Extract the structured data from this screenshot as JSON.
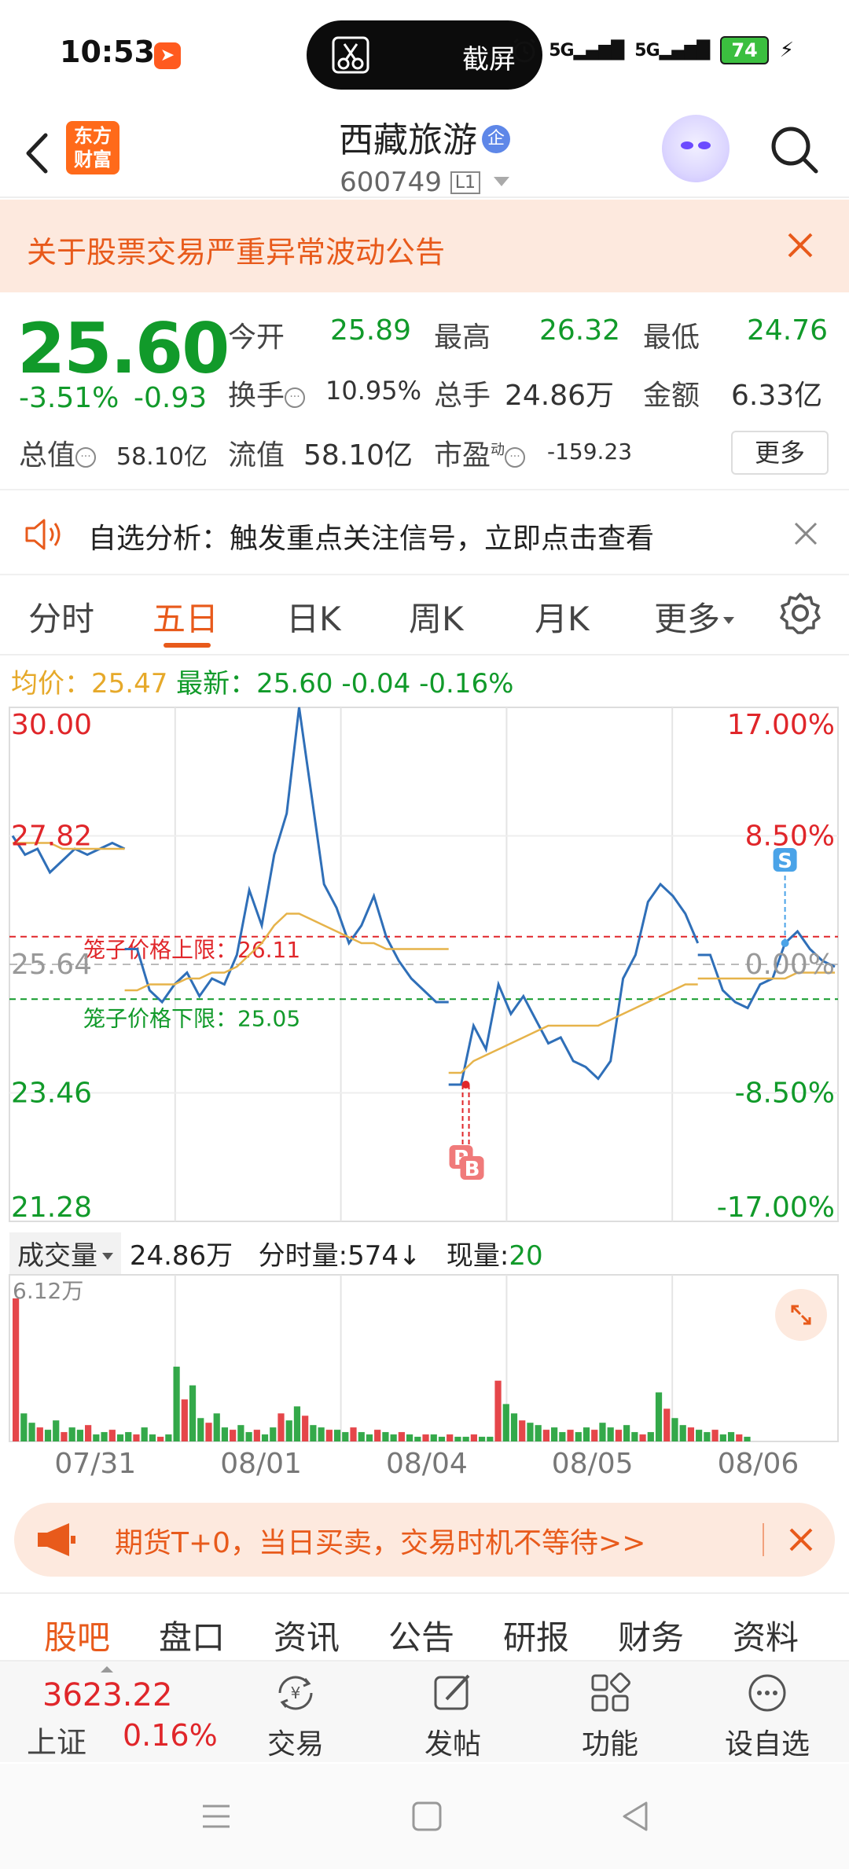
{
  "status_bar": {
    "time": "10:53",
    "screenshot_label": "截屏",
    "signal1": "5G",
    "signal2": "5G",
    "battery": "74",
    "icons": [
      "app-notification-icon",
      "scissors-icon",
      "alarm-icon",
      "signal-icon",
      "battery-icon",
      "charging-icon"
    ]
  },
  "header": {
    "logo_line1": "东方",
    "logo_line2": "财富",
    "stock_name": "西藏旅游",
    "badge": "企",
    "stock_code": "600749",
    "level_badge": "L1"
  },
  "notice": {
    "text": "关于股票交易严重异常波动公告"
  },
  "quote": {
    "price": "25.60",
    "change_pct": "-3.51%",
    "change": "-0.93",
    "open_label": "今开",
    "open": "25.89",
    "high_label": "最高",
    "high": "26.32",
    "low_label": "最低",
    "low": "24.76",
    "turnover_label": "换手",
    "turnover": "10.95%",
    "volume_label": "总手",
    "volume": "24.86万",
    "amount_label": "金额",
    "amount": "6.33亿",
    "mktcap_label": "总值",
    "mktcap": "58.10亿",
    "float_label": "流值",
    "float": "58.10亿",
    "pe_label": "市盈",
    "pe_sup": "动",
    "pe": "-159.23",
    "more": "更多"
  },
  "analysis": {
    "text": "自选分析：触发重点关注信号，立即点击查看"
  },
  "tabs": {
    "items": [
      "分时",
      "五日",
      "日K",
      "周K",
      "月K",
      "更多"
    ],
    "active_index": 1
  },
  "avg_bar": {
    "avg_label": "均价：",
    "avg": "25.47",
    "latest_label": "最新：",
    "latest": "25.60",
    "latest_chg": "-0.04",
    "latest_pct": "-0.16%"
  },
  "chart_data": {
    "type": "line",
    "title": "",
    "days": [
      "07/31",
      "08/01",
      "08/04",
      "08/05",
      "08/06"
    ],
    "price_axis": [
      "30.00",
      "27.82",
      "25.64",
      "23.46",
      "21.28"
    ],
    "pct_axis": [
      "17.00%",
      "8.50%",
      "0.00%",
      "-8.50%",
      "-17.00%"
    ],
    "ylim": [
      21.28,
      30.0
    ],
    "reference_price": 25.64,
    "cage_upper_label": "笼子价格上限：",
    "cage_upper": "26.11",
    "cage_lower_label": "笼子价格下限：",
    "cage_lower": "25.05",
    "markers": [
      "P",
      "B",
      "S"
    ],
    "series": [
      {
        "name": "price",
        "color": "#2f6fb8",
        "values": [
          27.82,
          27.5,
          27.6,
          27.2,
          27.4,
          27.6,
          27.5,
          27.6,
          27.7,
          27.6,
          25.9,
          25.2,
          25.0,
          25.3,
          25.5,
          25.1,
          25.4,
          25.3,
          25.8,
          26.9,
          26.3,
          27.5,
          28.2,
          30.0,
          28.5,
          27.0,
          26.6,
          26.0,
          26.3,
          26.8,
          26.1,
          25.7,
          25.4,
          25.2,
          25.0,
          25.0,
          23.6,
          24.6,
          24.2,
          25.3,
          24.8,
          25.1,
          24.7,
          24.3,
          24.4,
          24.0,
          23.9,
          23.7,
          24.0,
          25.4,
          25.8,
          26.7,
          27.0,
          26.8,
          26.5,
          26.0,
          25.8,
          25.2,
          25.0,
          24.9,
          25.3,
          25.4,
          26.0,
          26.2,
          25.9,
          25.7,
          25.6
        ],
        "day_breaks": [
          10,
          36,
          56
        ]
      },
      {
        "name": "avg",
        "color": "#e6b34a",
        "values": [
          27.7,
          27.7,
          27.7,
          27.7,
          27.6,
          27.6,
          27.6,
          27.6,
          27.6,
          27.6,
          25.2,
          25.3,
          25.3,
          25.3,
          25.4,
          25.4,
          25.5,
          25.5,
          25.6,
          25.8,
          26.0,
          26.3,
          26.5,
          26.5,
          26.4,
          26.3,
          26.2,
          26.1,
          26.0,
          26.0,
          25.9,
          25.9,
          25.9,
          25.9,
          25.9,
          25.9,
          23.8,
          24.0,
          24.1,
          24.2,
          24.3,
          24.4,
          24.5,
          24.6,
          24.6,
          24.6,
          24.6,
          24.6,
          24.7,
          24.8,
          24.9,
          25.0,
          25.1,
          25.2,
          25.3,
          25.3,
          25.4,
          25.4,
          25.4,
          25.4,
          25.4,
          25.4,
          25.4,
          25.5,
          25.5,
          25.5,
          25.5
        ]
      }
    ],
    "volume": {
      "label": "成交量",
      "total": "24.86万",
      "minute_label": "分时量:",
      "minute": "574",
      "current_label": "现量:",
      "current": "20",
      "max_label": "6.12万",
      "values": [
        6.12,
        1.2,
        0.8,
        0.6,
        0.5,
        0.9,
        0.4,
        0.6,
        0.5,
        0.7,
        0.3,
        0.4,
        0.5,
        0.3,
        0.4,
        0.3,
        0.6,
        0.3,
        0.2,
        0.3,
        3.2,
        1.8,
        2.4,
        1.0,
        0.8,
        1.2,
        0.6,
        0.5,
        0.7,
        0.4,
        0.5,
        0.3,
        0.6,
        1.2,
        0.9,
        1.5,
        1.1,
        0.7,
        0.6,
        0.5,
        0.5,
        0.4,
        0.6,
        0.4,
        0.3,
        0.5,
        0.4,
        0.3,
        0.4,
        0.3,
        0.2,
        0.3,
        0.3,
        0.2,
        0.3,
        0.2,
        0.2,
        0.3,
        0.2,
        0.2,
        2.6,
        1.6,
        1.2,
        0.9,
        0.8,
        0.7,
        0.5,
        0.6,
        0.4,
        0.5,
        0.4,
        0.6,
        0.5,
        0.8,
        0.6,
        0.5,
        0.7,
        0.4,
        0.3,
        0.4,
        2.1,
        1.4,
        1.0,
        0.7,
        0.6,
        0.5,
        0.4,
        0.5,
        0.3,
        0.4,
        0.3,
        0.2
      ]
    }
  },
  "promo": {
    "text": "期货T+0，当日买卖，交易时机不等待>>"
  },
  "subnav": {
    "items": [
      "股吧",
      "盘口",
      "资讯",
      "公告",
      "研报",
      "财务",
      "资料"
    ],
    "active_index": 0
  },
  "bottom_bar": {
    "index_value": "3623.22",
    "index_name": "上证",
    "index_change": "0.16%",
    "items": [
      {
        "label": "交易",
        "icon": "trade-yuan-icon"
      },
      {
        "label": "发帖",
        "icon": "edit-icon"
      },
      {
        "label": "功能",
        "icon": "grid-icon"
      },
      {
        "label": "设自选",
        "icon": "more-dots-icon"
      }
    ]
  },
  "colors": {
    "accent": "#e85a1b",
    "down": "#119a2a",
    "up": "#e0262a",
    "price_line": "#2f6fb8",
    "avg_line": "#e6b34a"
  }
}
